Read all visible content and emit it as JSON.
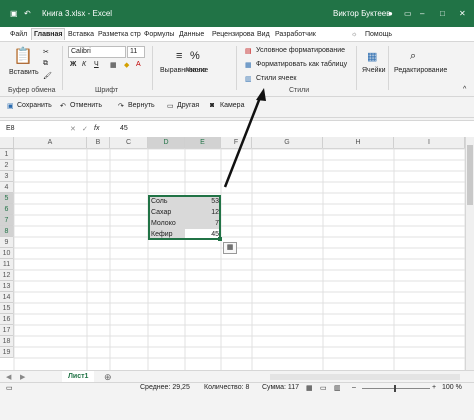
{
  "title_bar": {
    "file_title": "Книга 3.xlsx  -  Excel",
    "user_name": "Виктор Буктеев"
  },
  "ribbon_tabs": [
    "Файл",
    "Главная",
    "Вставка",
    "Разметка стр",
    "Формулы",
    "Данные",
    "Рецензирова",
    "Вид",
    "Разработчик",
    "Помощь"
  ],
  "active_tab": "Главная",
  "ribbon": {
    "paste_label": "Вставить",
    "clipboard_group": "Буфер обмена",
    "font_name": "Calibri",
    "font_size": "11",
    "bold": "Ж",
    "italic": "К",
    "underline": "Ч",
    "font_group": "Шрифт",
    "alignment_label": "Выравнивание",
    "number_label": "Число",
    "conditional_formatting": "Условное форматирование",
    "format_as_table": "Форматировать как таблицу",
    "cell_styles": "Стили ячеек",
    "styles_group": "Стили",
    "cells_label": "Ячейки",
    "editing_label": "Редактирование"
  },
  "quick_access": {
    "save": "Сохранить",
    "undo": "Отменить",
    "redo": "Вернуть",
    "other": "Другая",
    "camera": "Камера"
  },
  "formula_bar": {
    "name_box": "E8",
    "fx": "fx",
    "value": "45"
  },
  "columns": [
    "A",
    "B",
    "C",
    "D",
    "E",
    "F",
    "G",
    "H",
    "I"
  ],
  "rows": [
    "1",
    "2",
    "3",
    "4",
    "5",
    "6",
    "7",
    "8",
    "9",
    "10",
    "11",
    "12",
    "13",
    "14",
    "15",
    "16",
    "17",
    "18",
    "19"
  ],
  "table": [
    {
      "name": "Соль",
      "value": "53"
    },
    {
      "name": "Сахар",
      "value": "12"
    },
    {
      "name": "Молоко",
      "value": "7"
    },
    {
      "name": "Кефир",
      "value": "45"
    }
  ],
  "sheet_tab": "Лист1",
  "status": {
    "average": "Среднее: 29,25",
    "count": "Количество: 8",
    "sum": "Сумма: 117",
    "zoom": "100 %"
  },
  "colors": {
    "accent": "#217346",
    "arrow": "#111111"
  }
}
